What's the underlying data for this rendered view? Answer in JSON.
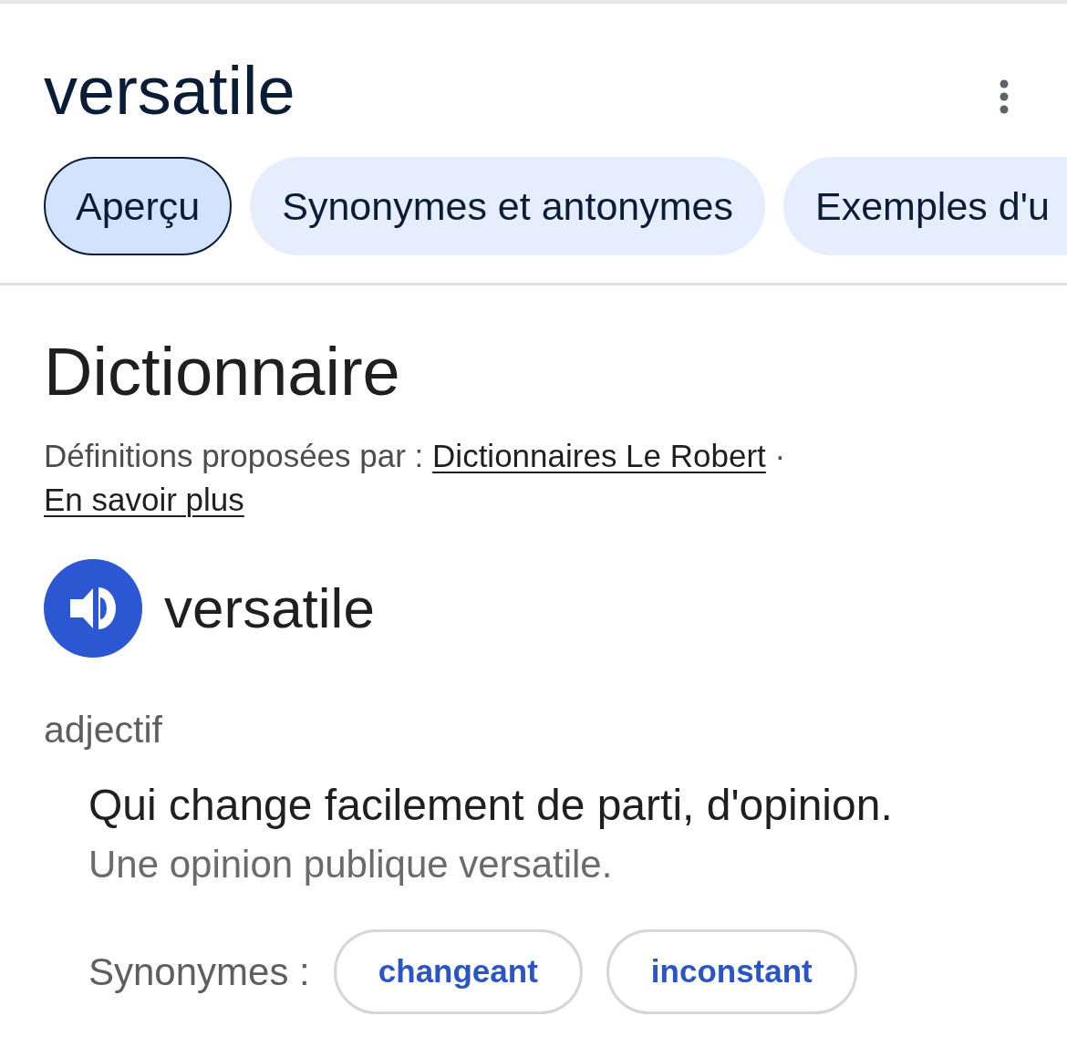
{
  "header": {
    "title": "versatile"
  },
  "tabs": [
    {
      "label": "Aperçu",
      "selected": true,
      "cut_off": false
    },
    {
      "label": "Synonymes et antonymes",
      "selected": false,
      "cut_off": false
    },
    {
      "label": "Exemples d'u",
      "selected": false,
      "cut_off": true
    }
  ],
  "dictionary": {
    "heading": "Dictionnaire",
    "attribution": {
      "prefix": "Définitions proposées par :",
      "source_link": "Dictionnaires Le Robert",
      "separator": "·",
      "learn_more_link": "En savoir plus"
    },
    "entry": {
      "word": "versatile",
      "part_of_speech": "adjectif",
      "senses": [
        {
          "definition": "Qui change facilement de parti, d'opinion.",
          "example": "Une opinion publique versatile.",
          "synonyms_label": "Synonymes :",
          "synonyms": [
            "changeant",
            "inconstant"
          ]
        }
      ]
    }
  }
}
